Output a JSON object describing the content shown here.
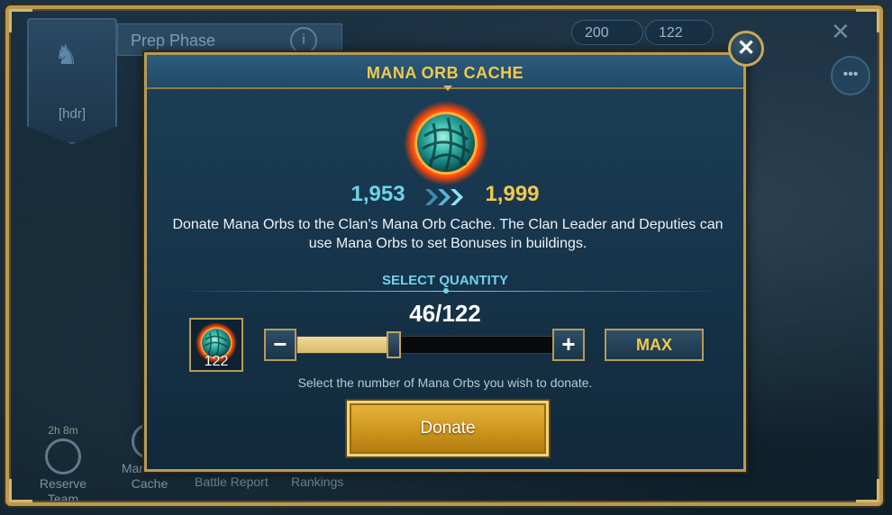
{
  "background": {
    "clan_tag": "[hdr]",
    "phase_label": "Prep Phase",
    "resources": [
      {
        "value": "200"
      },
      {
        "value": "122"
      }
    ],
    "bottom_nav": [
      {
        "label": "Reserve Team",
        "timer": "2h 8m"
      },
      {
        "label": "Mana Orb Cache",
        "timer": ""
      },
      {
        "label": "Battle Report"
      },
      {
        "label": "Rankings"
      }
    ]
  },
  "modal": {
    "title": "MANA ORB CACHE",
    "close_icon": "close-icon",
    "orb_icon": "mana-orb-icon",
    "count_from": "1,953",
    "count_to": "1,999",
    "description": "Donate Mana Orbs to the Clan's Mana Orb Cache. The Clan Leader and Deputies can use Mana Orbs to set Bonuses in buildings.",
    "select_label": "SELECT QUANTITY",
    "quantity_display": "46/122",
    "quantity": {
      "selected": 46,
      "max": 122
    },
    "owned_count": "122",
    "minus_label": "−",
    "plus_label": "+",
    "max_label": "MAX",
    "hint": "Select the number of Mana Orbs you wish to donate.",
    "donate_label": "Donate"
  },
  "colors": {
    "gold_text": "#f2c84c",
    "cyan_text": "#6fd3ea",
    "frame_gold": "#b79a56",
    "donate_button": "#cf981f"
  }
}
